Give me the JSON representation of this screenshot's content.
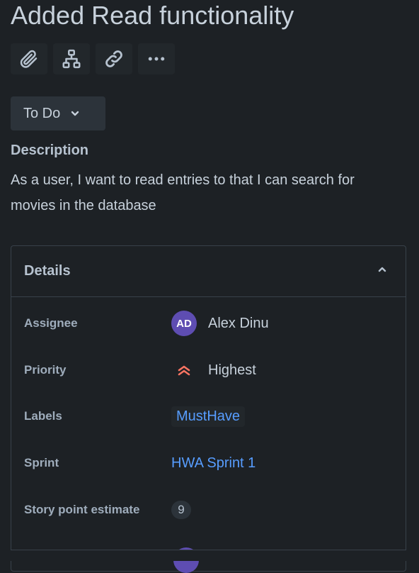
{
  "issue": {
    "title": "Added Read functionality"
  },
  "toolbar": {
    "buttons": [
      {
        "icon": "paperclip-icon"
      },
      {
        "icon": "hierarchy-icon"
      },
      {
        "icon": "link-icon"
      },
      {
        "icon": "more-icon"
      }
    ]
  },
  "status": {
    "label": "To Do"
  },
  "description": {
    "heading": "Description",
    "text": "As a user, I want to read entries to that I can search for movies in the database"
  },
  "details": {
    "title": "Details",
    "assignee": {
      "label": "Assignee",
      "initials": "AD",
      "name": "Alex Dinu"
    },
    "priority": {
      "label": "Priority",
      "value": "Highest"
    },
    "labels": {
      "label": "Labels",
      "value": "MustHave"
    },
    "sprint": {
      "label": "Sprint",
      "value": "HWA Sprint 1"
    },
    "story_points": {
      "label": "Story point estimate",
      "value": "9"
    }
  },
  "colors": {
    "background": "#1d2125",
    "link": "#579dff",
    "avatar": "#5e4db2",
    "priority": "#f87462"
  }
}
